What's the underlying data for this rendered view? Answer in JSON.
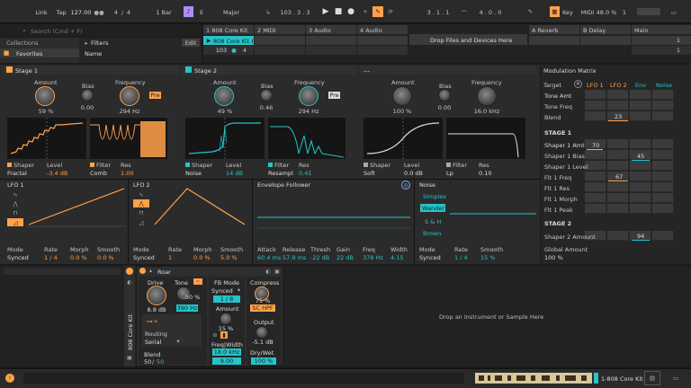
{
  "transport": {
    "link": "Link",
    "tap": "Tap",
    "tempo": "127.00",
    "sig_num": "4",
    "sig_div": "/",
    "sig_den": "4",
    "quant": "1 Bar",
    "key": "E",
    "scale": "Major",
    "position": "103 .   3 .   3",
    "loop_start": "3 .   1 .   1",
    "loop_len": "4 .   0 .   0",
    "key_label": "Key",
    "midi_label": "MIDI",
    "cpu": "48.0 %",
    "cpu_num": "1"
  },
  "browser": {
    "search_placeholder": "Search (Cmd + F)",
    "collections": "Collections",
    "favorites": "Favorites",
    "filters": "Filters",
    "edit": "Edit",
    "name_col": "Name"
  },
  "tracks": [
    {
      "name": "1 808 Core Kit",
      "clip": "808 Core Kit E",
      "num": "103",
      "num2": "4"
    },
    {
      "name": "2 MIDI"
    },
    {
      "name": "3 Audio"
    },
    {
      "name": "4 Audio"
    }
  ],
  "drop_files": "Drop Files and Devices Here",
  "returns": [
    {
      "name": "A Reverb"
    },
    {
      "name": "B Delay"
    },
    {
      "name": "Main",
      "num": "1",
      "num2": "1"
    }
  ],
  "stage1": {
    "title": "Stage 1",
    "amount_l": "Amount",
    "amount_v": "59 %",
    "bias_l": "Bias",
    "bias_v": "0.00",
    "freq_l": "Frequency",
    "freq_v": "294 Hz",
    "pre": "Pre",
    "shaper_l": "Shaper",
    "shaper_v": "Fractal",
    "level_l": "Level",
    "level_v": "-3.4 dB",
    "filter_l": "Filter",
    "filter_v": "Comb",
    "res_l": "Res",
    "res_v": "1.00"
  },
  "stage2": {
    "title": "Stage 2",
    "amount_l": "Amount",
    "amount_v": "49 %",
    "bias_l": "Bias",
    "bias_v": "0.46",
    "freq_l": "Frequency",
    "freq_v": "294 Hz",
    "pre": "Pre",
    "shaper_l": "Shaper",
    "shaper_v": "Noise",
    "level_l": "Level",
    "level_v": "14 dB",
    "filter_l": "Filter",
    "filter_v": "Resampl",
    "res_l": "Res",
    "res_v": "0.41"
  },
  "stage3": {
    "title": "---",
    "amount_l": "Amount",
    "amount_v": "100 %",
    "bias_l": "Bias",
    "bias_v": "0.00",
    "freq_l": "Frequency",
    "freq_v": "16.0 kHz",
    "shaper_l": "Shaper",
    "shaper_v": "Soft",
    "level_l": "Level",
    "level_v": "0.0 dB",
    "filter_l": "Filter",
    "filter_v": "Lp",
    "res_l": "Res",
    "res_v": "0.10"
  },
  "modmatrix": {
    "title": "Modulation Matrix",
    "target": "Target",
    "cols": [
      "LFO 1",
      "LFO 2",
      "Env",
      "Noise"
    ],
    "rows": [
      "Tone Amt",
      "Tone Freq",
      "Blend"
    ],
    "blend_val": "23",
    "stage1": "STAGE 1",
    "rows1": [
      "Shaper 1 Amt",
      "Shaper 1 Bias",
      "Shaper 1 Level",
      "Flt 1 Freq",
      "Flt 1 Res",
      "Flt 1 Morph",
      "Flt 1 Peak"
    ],
    "v_amt": "70",
    "v_bias": "45",
    "v_freq": "67",
    "stage2": "STAGE 2",
    "rows2": [
      "Shaper 2 Amount"
    ],
    "v_s2": "94",
    "global_l": "Global Amount",
    "global_v": "100 %"
  },
  "lfo1": {
    "title": "LFO 1",
    "mode_l": "Mode",
    "mode_v": "Synced",
    "rate_l": "Rate",
    "rate_v": "1 / 4",
    "morph_l": "Morph",
    "morph_v": "0.0 %",
    "smooth_l": "Smooth",
    "smooth_v": "0.0 %"
  },
  "lfo2": {
    "title": "LFO 2",
    "mode_l": "Mode",
    "mode_v": "Synced",
    "rate_l": "Rate",
    "rate_v": "1",
    "morph_l": "Morph",
    "morph_v": "0.0 %",
    "smooth_l": "Smooth",
    "smooth_v": "5.0 %"
  },
  "env": {
    "title": "Envelope Follower",
    "attack_l": "Attack",
    "attack_v": "60.4 ms",
    "release_l": "Release",
    "release_v": "57.9 ms",
    "thresh_l": "Thresh",
    "thresh_v": "-22 dB",
    "gain_l": "Gain",
    "gain_v": "22 dB",
    "freq_l": "Freq",
    "freq_v": "378 Hz",
    "width_l": "Width",
    "width_v": "4.15"
  },
  "noise": {
    "title": "Noise",
    "types": [
      "Simplex",
      "Wander",
      "S & H",
      "Brown"
    ],
    "mode_l": "Mode",
    "mode_v": "Synced",
    "rate_l": "Rate",
    "rate_v": "1 / 4",
    "smooth_l": "Smooth",
    "smooth_v": "15 %"
  },
  "roar": {
    "title": "Roar",
    "track": "808 Core Kit",
    "drive_l": "Drive",
    "drive_v": "8.8 dB",
    "tone_l": "Tone",
    "tone_v": "-50 %",
    "tone_freq": "390 Hz",
    "routing_l": "Routing",
    "routing_v": "Serial",
    "blend_l": "Blend",
    "blend_a": "50",
    "blend_b": "50",
    "fb_l": "FB Mode",
    "fb_v": "Synced",
    "fb_rate": "1 / 8",
    "amount_l": "Amount",
    "amount_v": "15 %",
    "freqw_l": "Freq|Width",
    "freqw_v": "18.0 kHz",
    "freqw_v2": "9.00",
    "comp_l": "Compress",
    "comp_v": "75 %",
    "schpf": "SC HPF",
    "output_l": "Output",
    "output_v": "-5.1 dB",
    "drywet_l": "Dry/Wet",
    "drywet_v": "100 %"
  },
  "drop_instrument": "Drop an Instrument or Sample Here",
  "status": {
    "track": "1-808 Core Kit"
  },
  "colors": {
    "orange": "#ffa24a",
    "cyan": "#25c4c8",
    "green": "#2bd07a"
  }
}
